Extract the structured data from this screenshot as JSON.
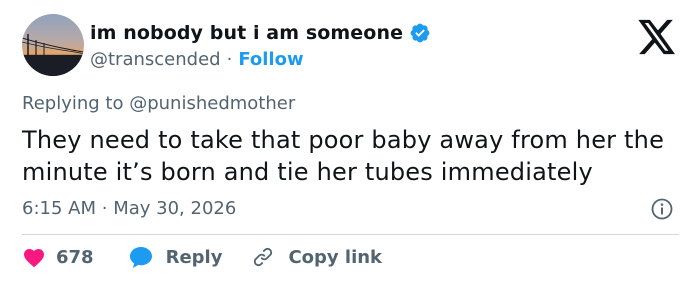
{
  "author": {
    "display_name": "im nobody but i am someone",
    "handle": "@transcended",
    "separator": "·",
    "follow_label": "Follow"
  },
  "reply_context": {
    "prefix": "Replying to",
    "mention": "@punishedmother"
  },
  "tweet": {
    "text": "They need to take that poor baby away from her the minute it’s born and tie her tubes immediately",
    "time": "6:15 AM",
    "separator": "·",
    "date": "May 30, 2026"
  },
  "actions": {
    "like_count": "678",
    "reply_label": "Reply",
    "copy_link_label": "Copy link"
  },
  "colors": {
    "accent": "#1d9bf0",
    "like": "#f91880",
    "text": "#0f1419",
    "secondary": "#536471"
  },
  "icons": [
    "x-logo-icon",
    "verified-badge-icon",
    "info-icon",
    "heart-icon",
    "reply-bubble-icon",
    "link-icon"
  ]
}
